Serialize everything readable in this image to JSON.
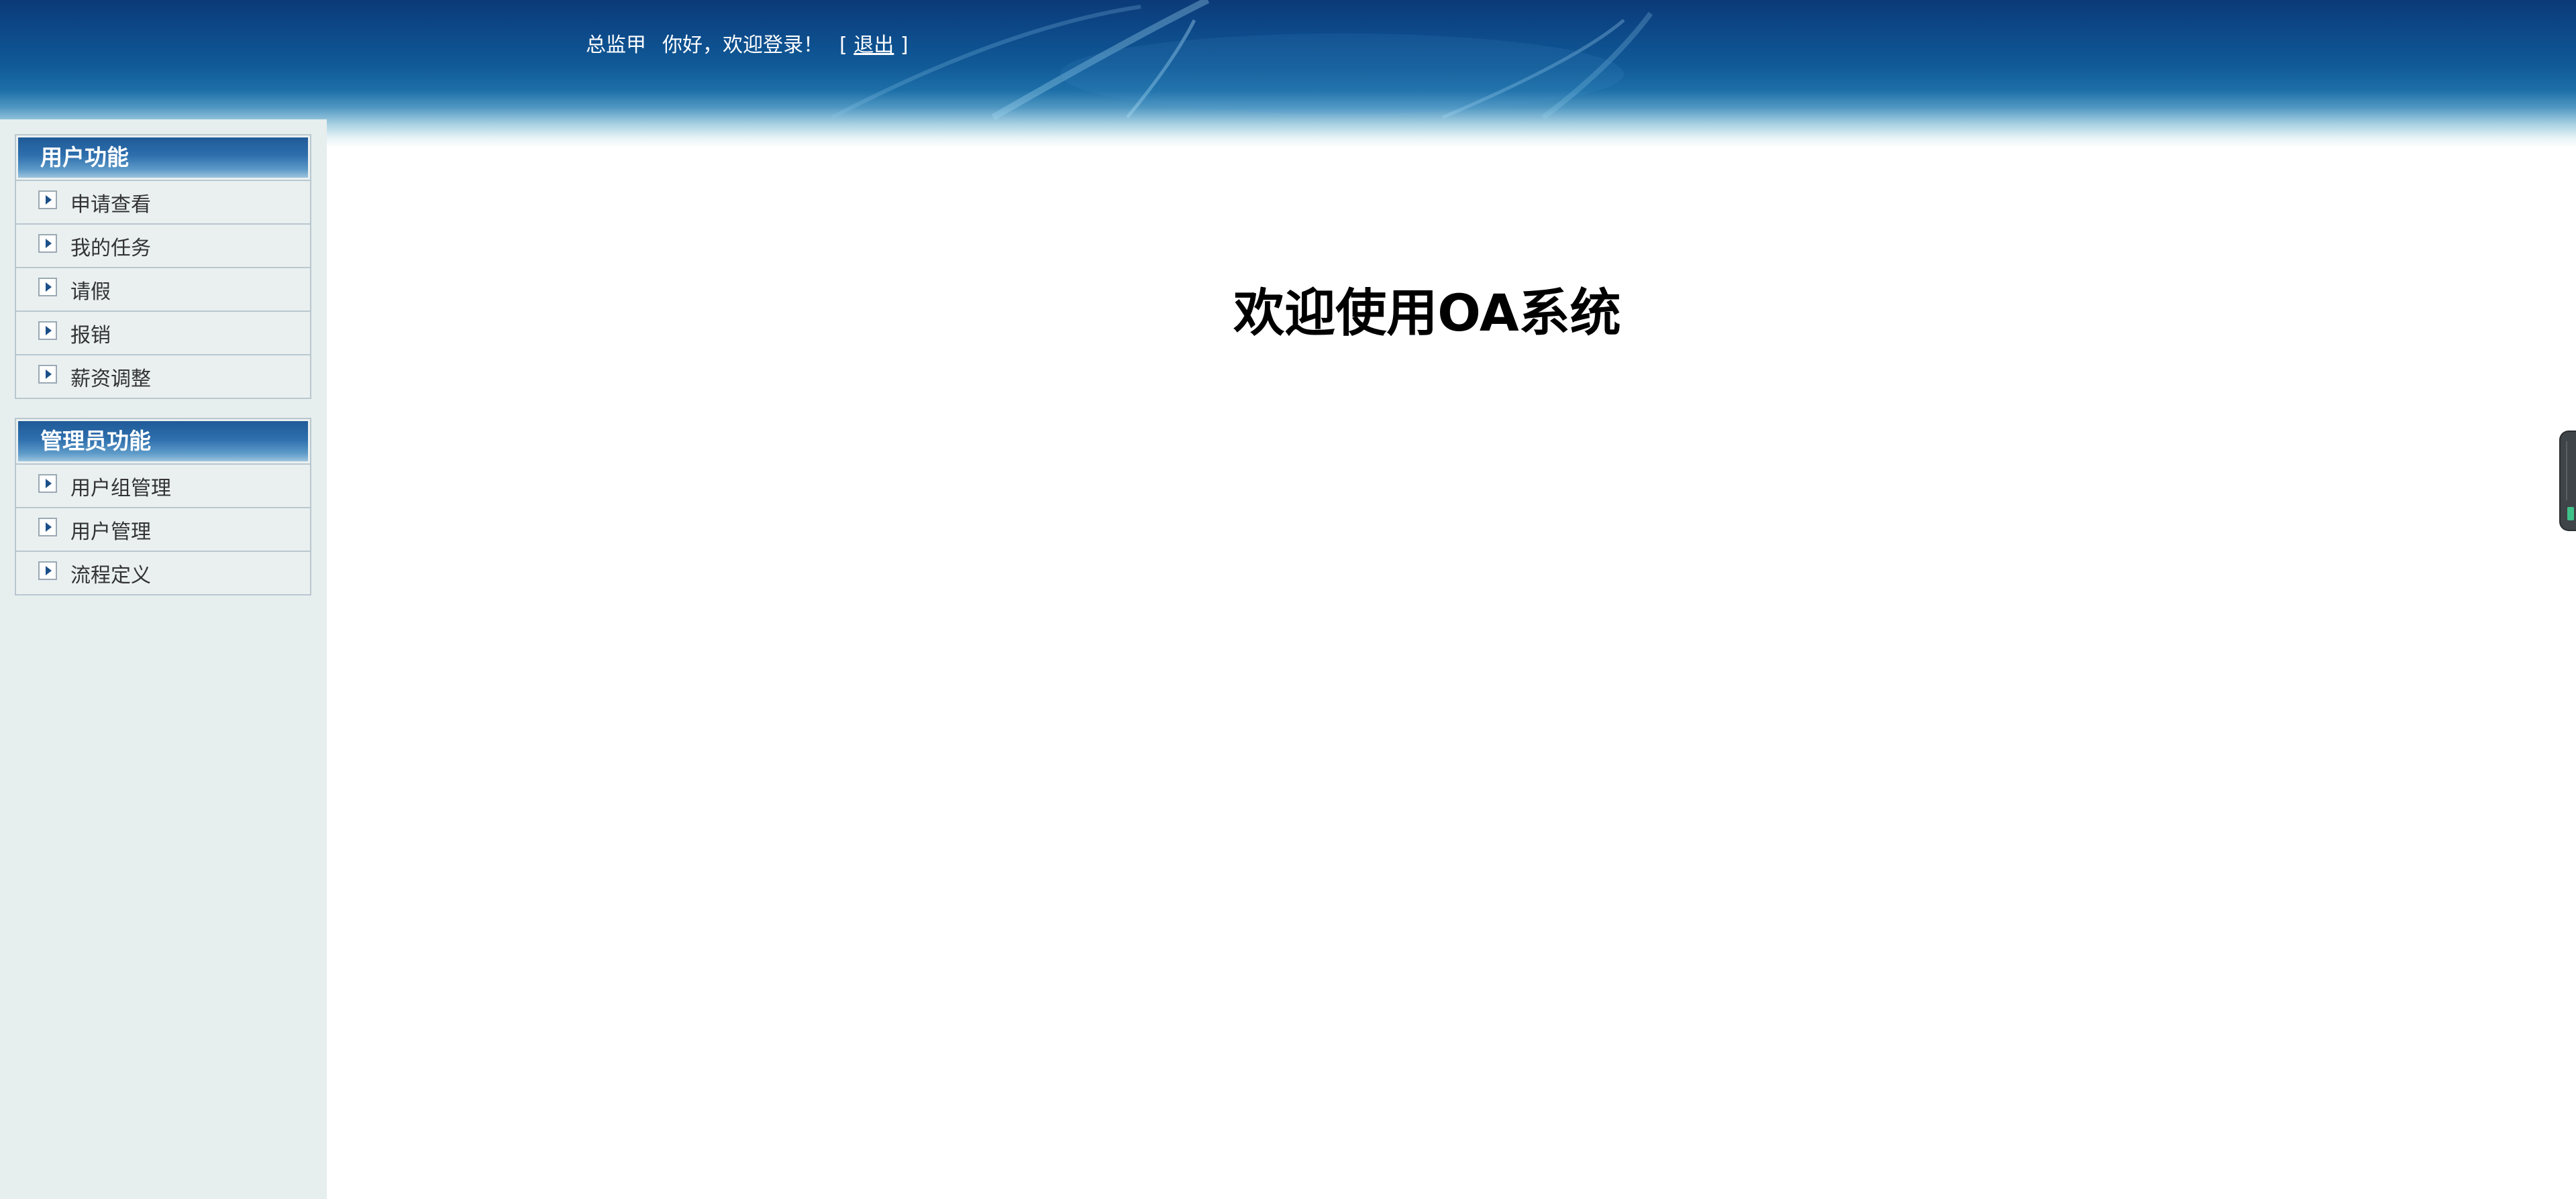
{
  "header": {
    "user_name": "总监甲",
    "greeting": "你好，欢迎登录！",
    "bracket_open": "[",
    "logout_label": "退出",
    "bracket_close": "]"
  },
  "sidebar": {
    "groups": [
      {
        "title": "用户功能",
        "items": [
          {
            "label": "申请查看"
          },
          {
            "label": "我的任务"
          },
          {
            "label": "请假"
          },
          {
            "label": "报销"
          },
          {
            "label": "薪资调整"
          }
        ]
      },
      {
        "title": "管理员功能",
        "items": [
          {
            "label": "用户组管理"
          },
          {
            "label": "用户管理"
          },
          {
            "label": "流程定义"
          }
        ]
      }
    ]
  },
  "main": {
    "title": "欢迎使用OA系统"
  },
  "colors": {
    "header_top": "#0b3a78",
    "sidebar_bg": "#e7eeee",
    "menu_title_bg": "#1f5a98",
    "menu_border": "#b9c7cf"
  },
  "icons": {
    "menu_item_icon": "arrow-right-box-icon",
    "side_widget": "side-panel-handle-icon"
  }
}
